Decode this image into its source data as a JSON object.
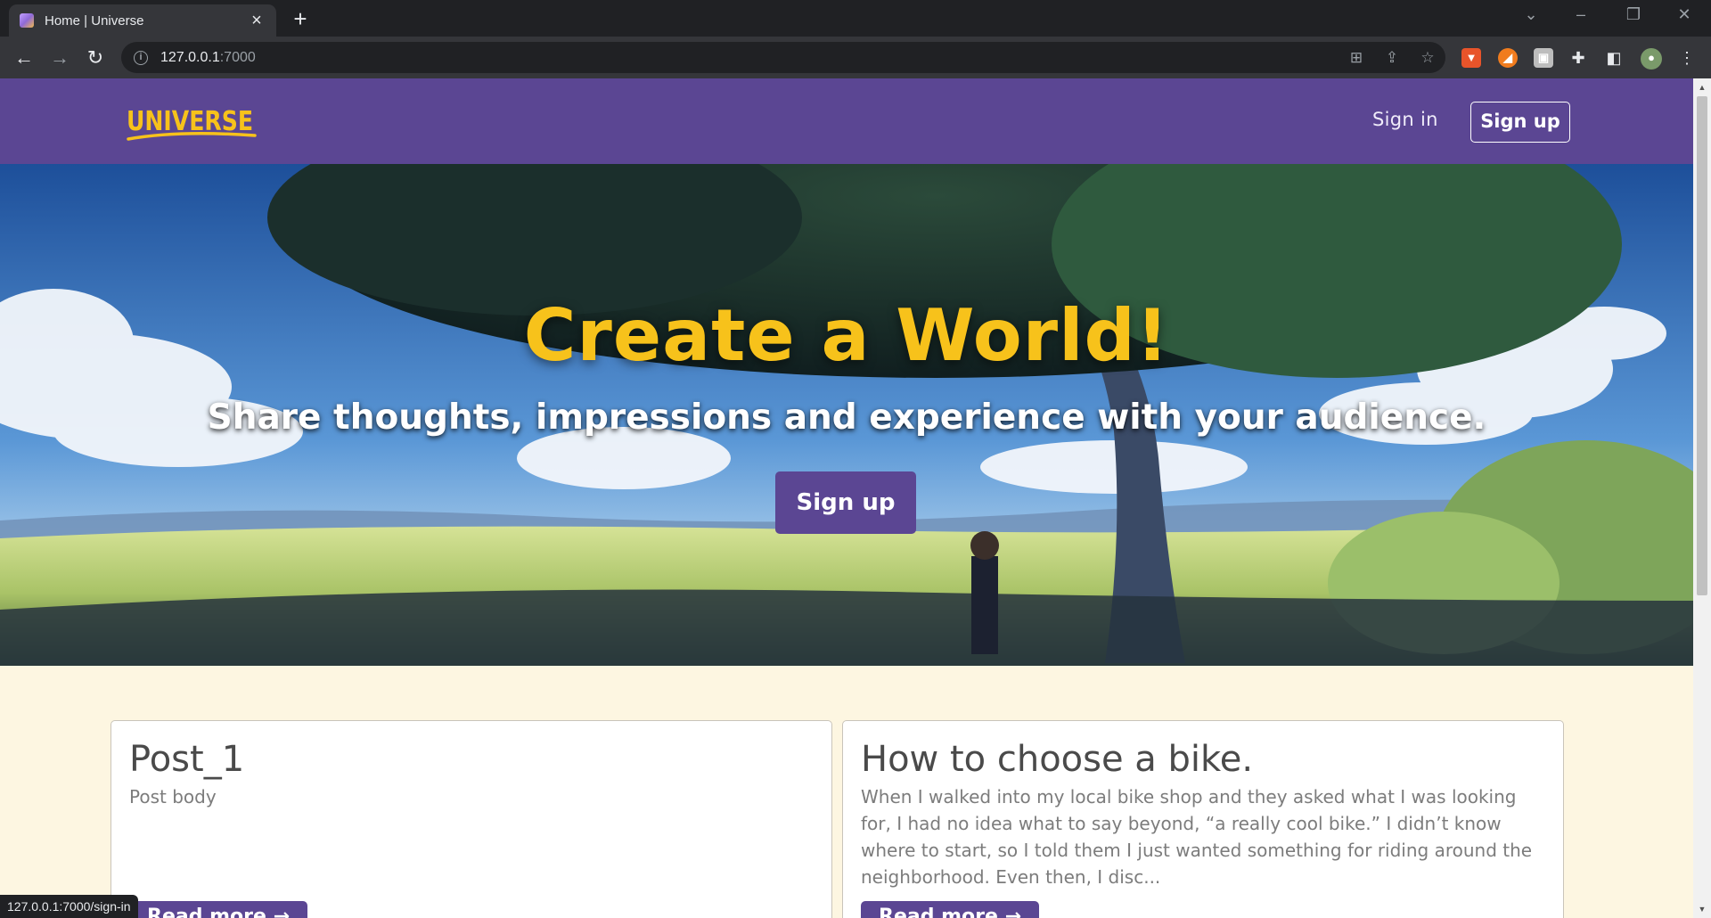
{
  "browser": {
    "tab_title": "Home | Universe",
    "url_host": "127.0.0.1",
    "url_port": ":7000",
    "status_url": "127.0.0.1:7000/sign-in"
  },
  "navbar": {
    "logo_text": "UNIVERSE",
    "signin_label": "Sign in",
    "signup_label": "Sign up"
  },
  "hero": {
    "title": "Create a World!",
    "subtitle": "Share thoughts, impressions and experience with your audience.",
    "signup_label": "Sign up"
  },
  "posts": [
    {
      "title": "Post_1",
      "body": "Post body",
      "button_label": "Read more →"
    },
    {
      "title": "How to choose a bike.",
      "body": "When I walked into my local bike shop and they asked what I was looking for, I had no idea what to say beyond, “a really cool bike.” I didn’t know where to start, so I told them I just wanted something for riding around the neighborhood. Even then, I disc...",
      "button_label": "Read more →"
    }
  ],
  "colors": {
    "navbar": "#5b4693",
    "accent_yellow": "#f7c21b",
    "page_background": "#fdf6e1"
  }
}
